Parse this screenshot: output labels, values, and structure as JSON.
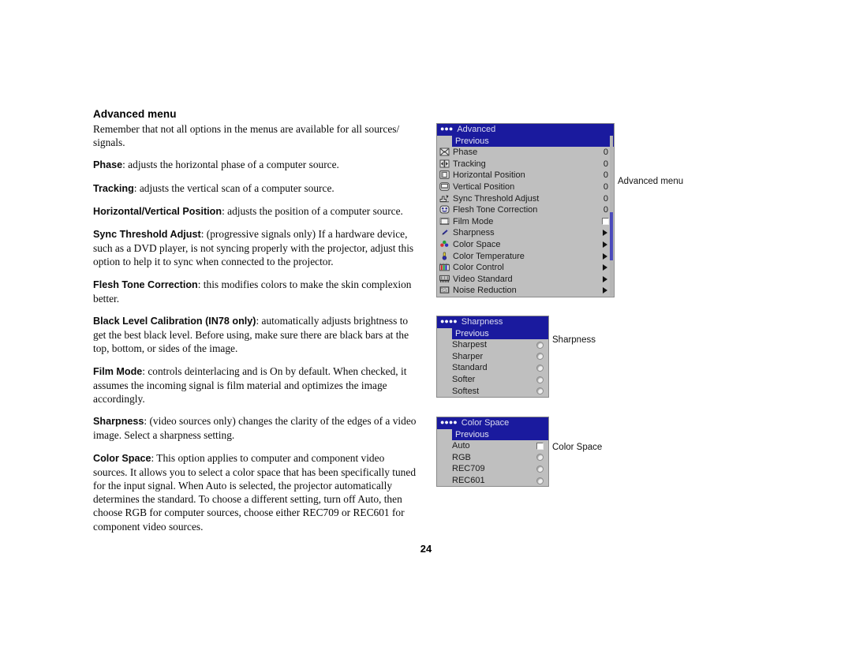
{
  "document": {
    "heading": "Advanced menu",
    "page_number": "24",
    "paragraphs": [
      {
        "term": "",
        "text": "Remember that not all options in the menus are available for all sources/ signals."
      },
      {
        "term": "Phase",
        "text": ": adjusts the horizontal phase of a computer source."
      },
      {
        "term": "Tracking",
        "text": ": adjusts the vertical scan of a computer source."
      },
      {
        "term": "Horizontal/Vertical Position",
        "text": ": adjusts the position of a computer source."
      },
      {
        "term": "Sync Threshold Adjust",
        "text": ": (progressive signals only) If a hardware device, such as a DVD player, is not syncing properly with the projector, adjust this option to help it to sync when connected to the projector."
      },
      {
        "term": "Flesh Tone Correction",
        "text": ": this modifies colors to make the skin complexion better."
      },
      {
        "term": "Black Level Calibration (IN78 only)",
        "text": ": automatically adjusts brightness to get the best black level. Before using, make sure there are black bars at the top, bottom, or sides of the image."
      },
      {
        "term": "Film Mode",
        "text": ": controls deinterlacing and is On by default. When checked, it assumes the incoming signal is film material and optimizes the image accordingly."
      },
      {
        "term": "Sharpness",
        "text": ": (video sources only) changes the clarity of the edges of a video image. Select a sharpness setting."
      },
      {
        "term": "Color Space",
        "text": ": This option applies to computer and component video sources. It allows you to select a color space that has been specifically tuned for the input signal. When Auto is selected, the projector automatically determines the standard. To choose a different setting, turn off Auto, then choose RGB for computer sources, choose either REC709 or REC601 for component video sources."
      }
    ]
  },
  "colors": {
    "osd_title_bg": "#1a1a9e",
    "osd_body_bg": "#bfbfbf",
    "osd_border": "#8a8a8a",
    "osd_text": "#1b1b1b",
    "scroll_thumb": "#4b4bbb"
  },
  "advanced_menu": {
    "dots": "●●●",
    "title": "Advanced",
    "previous_label": "Previous",
    "caption": "Advanced menu",
    "items": [
      {
        "icon": "phase-icon",
        "label": "Phase",
        "control": "value",
        "value": "0"
      },
      {
        "icon": "tracking-icon",
        "label": "Tracking",
        "control": "value",
        "value": "0"
      },
      {
        "icon": "horizontal-position-icon",
        "label": "Horizontal Position",
        "control": "value",
        "value": "0"
      },
      {
        "icon": "vertical-position-icon",
        "label": "Vertical Position",
        "control": "value",
        "value": "0"
      },
      {
        "icon": "sync-threshold-icon",
        "label": "Sync Threshold Adjust",
        "control": "value",
        "value": "0"
      },
      {
        "icon": "flesh-tone-icon",
        "label": "Flesh Tone Correction",
        "control": "value",
        "value": "0"
      },
      {
        "icon": "film-mode-icon",
        "label": "Film Mode",
        "control": "checkbox",
        "value": ""
      },
      {
        "icon": "sharpness-icon",
        "label": "Sharpness",
        "control": "arrow",
        "value": ""
      },
      {
        "icon": "color-space-icon",
        "label": "Color Space",
        "control": "arrow",
        "value": ""
      },
      {
        "icon": "color-temperature-icon",
        "label": "Color Temperature",
        "control": "arrow",
        "value": ""
      },
      {
        "icon": "color-control-icon",
        "label": "Color Control",
        "control": "arrow",
        "value": ""
      },
      {
        "icon": "video-standard-icon",
        "label": "Video Standard",
        "control": "arrow",
        "value": ""
      },
      {
        "icon": "noise-reduction-icon",
        "label": "Noise Reduction",
        "control": "arrow",
        "value": ""
      }
    ]
  },
  "sharpness_menu": {
    "dots": "●●●●",
    "title": "Sharpness",
    "previous_label": "Previous",
    "caption": "Sharpness",
    "items": [
      {
        "label": "Sharpest",
        "control": "radio"
      },
      {
        "label": "Sharper",
        "control": "radio"
      },
      {
        "label": "Standard",
        "control": "radio"
      },
      {
        "label": "Softer",
        "control": "radio"
      },
      {
        "label": "Softest",
        "control": "radio"
      }
    ]
  },
  "color_space_menu": {
    "dots": "●●●●",
    "title": "Color Space",
    "previous_label": "Previous",
    "caption": "Color Space",
    "items": [
      {
        "label": "Auto",
        "control": "checkbox"
      },
      {
        "label": "RGB",
        "control": "radio"
      },
      {
        "label": "REC709",
        "control": "radio"
      },
      {
        "label": "REC601",
        "control": "radio"
      }
    ]
  }
}
